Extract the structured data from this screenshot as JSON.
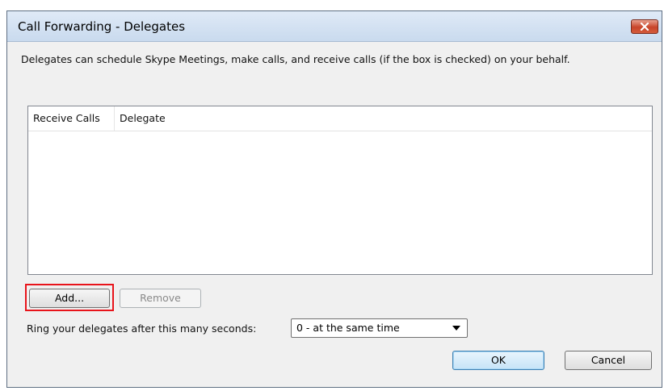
{
  "window": {
    "title": "Call Forwarding - Delegates",
    "close_icon": "close-icon"
  },
  "description": "Delegates can schedule Skype Meetings, make calls, and receive calls (if the box is checked) on your behalf.",
  "delegates_list": {
    "columns": [
      "Receive Calls",
      "Delegate"
    ],
    "rows": []
  },
  "buttons": {
    "add": "Add...",
    "remove": "Remove",
    "ok": "OK",
    "cancel": "Cancel"
  },
  "ring": {
    "label": "Ring your delegates after this many seconds:",
    "selected": "0 - at the same time"
  },
  "colors": {
    "highlight": "#e8141b",
    "close_button": "#c8452a"
  }
}
